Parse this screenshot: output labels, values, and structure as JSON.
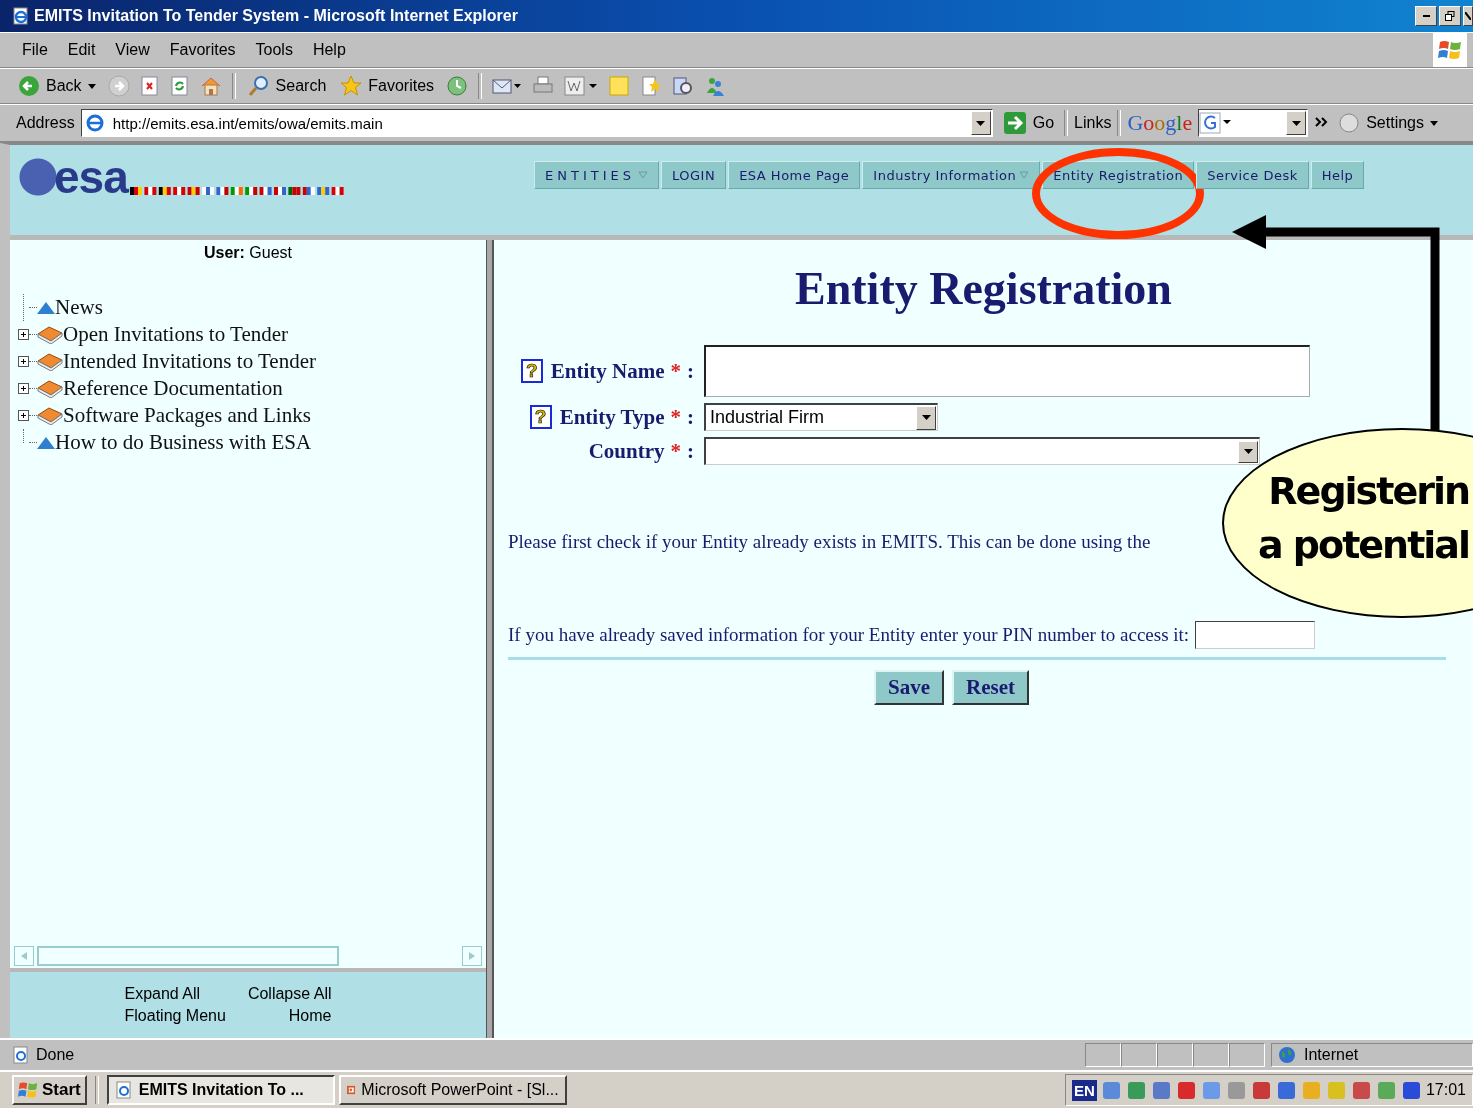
{
  "window": {
    "title": "EMITS Invitation To Tender System - Microsoft Internet Explorer"
  },
  "menu": [
    "File",
    "Edit",
    "View",
    "Favorites",
    "Tools",
    "Help"
  ],
  "toolbar": {
    "back": "Back",
    "search": "Search",
    "favorites": "Favorites"
  },
  "address_bar": {
    "label": "Address",
    "url": "http://emits.esa.int/emits/owa/emits.main",
    "go": "Go",
    "links": "Links",
    "google": "Google",
    "settings": "Settings"
  },
  "header": {
    "logo": "esa",
    "nav_tabs": [
      {
        "label": "ENTITIES",
        "dropdown": true,
        "highlighted": false
      },
      {
        "label": "LOGIN",
        "dropdown": false,
        "highlighted": false
      },
      {
        "label": "ESA Home Page",
        "dropdown": false,
        "highlighted": false
      },
      {
        "label": "Industry Information",
        "dropdown": true,
        "highlighted": false
      },
      {
        "label": "Entity Registration",
        "dropdown": false,
        "highlighted": true
      },
      {
        "label": "Service Desk",
        "dropdown": false,
        "highlighted": false
      },
      {
        "label": "Help",
        "dropdown": false,
        "highlighted": false
      }
    ]
  },
  "sidebar": {
    "user_label": "User:",
    "user": "Guest",
    "tree": [
      {
        "label": "News",
        "kind": "page",
        "expandable": false
      },
      {
        "label": "Open Invitations to Tender",
        "kind": "book",
        "expandable": true
      },
      {
        "label": "Intended Invitations to Tender",
        "kind": "book",
        "expandable": true
      },
      {
        "label": "Reference Documentation",
        "kind": "book",
        "expandable": true
      },
      {
        "label": "Software Packages and Links",
        "kind": "book",
        "expandable": true
      },
      {
        "label": "How to do Business with ESA",
        "kind": "page",
        "expandable": false
      }
    ],
    "footer_links": [
      "Expand All",
      "Collapse All",
      "Floating Menu",
      "Home"
    ]
  },
  "form": {
    "title": "Entity Registration",
    "fields": [
      {
        "label": "Entity Name",
        "kind": "text",
        "required_mark": "*",
        "separator": ":",
        "help_icon": "?"
      },
      {
        "label": "Entity Type",
        "kind": "select",
        "value": "Industrial Firm",
        "required_mark": "*",
        "separator": ":",
        "help_icon": "?"
      },
      {
        "label": "Country",
        "kind": "select_wide",
        "required_mark": "*",
        "separator": ":"
      }
    ],
    "notice": "Please first check if your Entity already exists in EMITS. This can be done using the",
    "pin_prompt": "If you have already saved information for your Entity enter your PIN number to access it:",
    "buttons": [
      "Save",
      "Reset"
    ]
  },
  "status_bar": {
    "text": "Done",
    "zone": "Internet"
  },
  "taskbar": {
    "start": "Start",
    "tasks": [
      {
        "label": "EMITS Invitation To ...",
        "selected": true,
        "kind": "browser"
      },
      {
        "label": "Microsoft PowerPoint - [Sl...",
        "selected": false,
        "kind": "slides"
      }
    ],
    "language": "EN",
    "clock": "17:01"
  },
  "annotation": {
    "callout": [
      "Registerin",
      "a potential"
    ]
  }
}
